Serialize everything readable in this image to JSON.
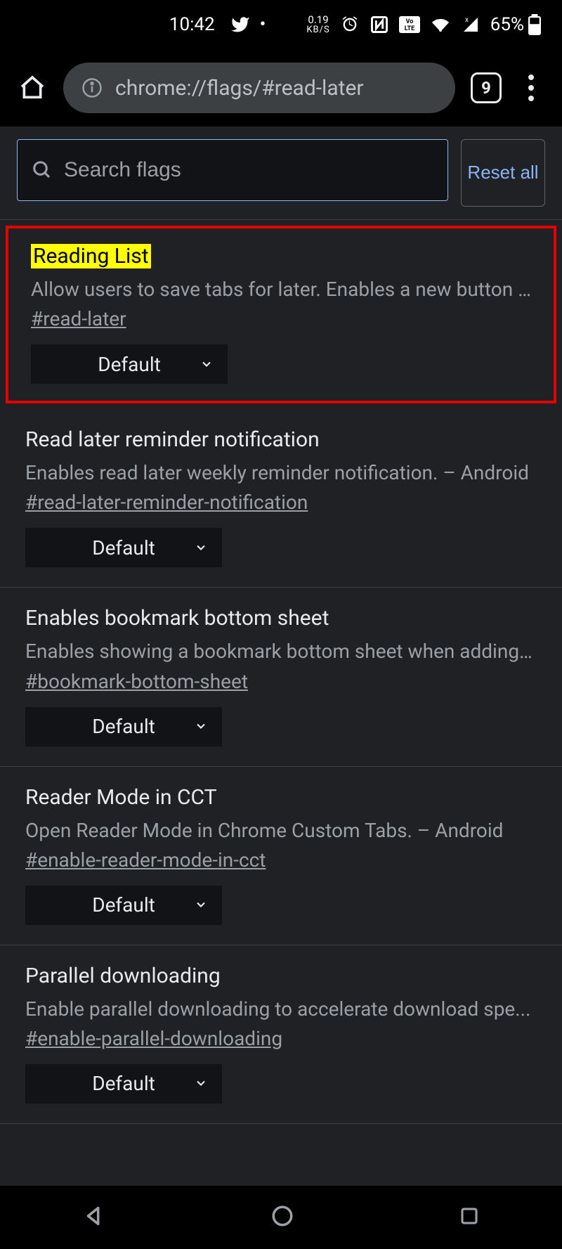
{
  "status": {
    "time": "10:42",
    "kbs_value": "0.19",
    "kbs_unit": "KB/S",
    "battery": "65%"
  },
  "chrome": {
    "url": "chrome://flags/#read-later",
    "tab_count": "9"
  },
  "search": {
    "placeholder": "Search flags",
    "reset_label": "Reset all"
  },
  "flags": [
    {
      "title": "Reading List",
      "desc": "Allow users to save tabs for later. Enables a new button a...",
      "anchor": "#read-later",
      "value": "Default",
      "highlight": true,
      "wrap": false
    },
    {
      "title": "Read later reminder notification",
      "desc": "Enables read later weekly reminder notification. – Android",
      "anchor": "#read-later-reminder-notification",
      "value": "Default",
      "highlight": false,
      "wrap": true
    },
    {
      "title": "Enables bookmark bottom sheet",
      "desc": "Enables showing a bookmark bottom sheet when adding ...",
      "anchor": "#bookmark-bottom-sheet",
      "value": "Default",
      "highlight": false,
      "wrap": false
    },
    {
      "title": "Reader Mode in CCT",
      "desc": "Open Reader Mode in Chrome Custom Tabs. – Android",
      "anchor": "#enable-reader-mode-in-cct",
      "value": "Default",
      "highlight": false,
      "wrap": true
    },
    {
      "title": "Parallel downloading",
      "desc": "Enable parallel downloading to accelerate download spe...",
      "anchor": "#enable-parallel-downloading",
      "value": "Default",
      "highlight": false,
      "wrap": false
    }
  ]
}
